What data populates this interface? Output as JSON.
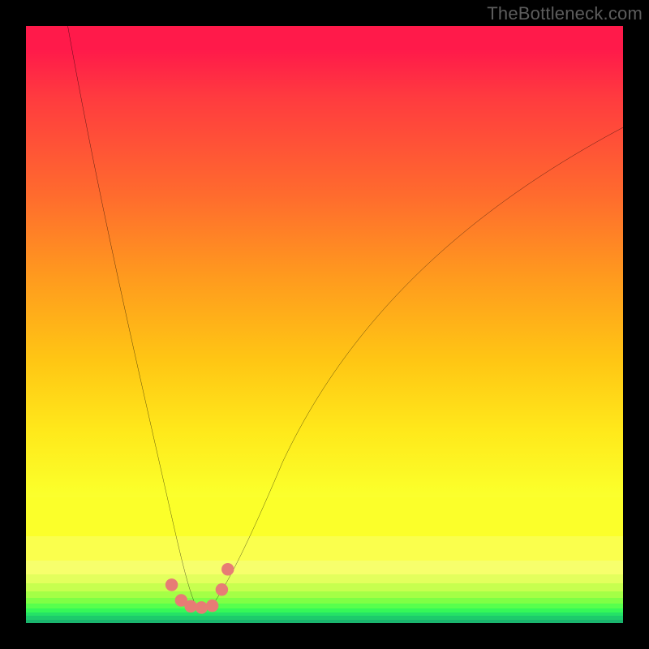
{
  "watermark": "TheBottleneck.com",
  "chart_data": {
    "type": "line",
    "title": "",
    "xlabel": "",
    "ylabel": "",
    "xlim": [
      0,
      100
    ],
    "ylim": [
      0,
      100
    ],
    "series": [
      {
        "name": "curve",
        "x": [
          7,
          10,
          13,
          16,
          19,
          21,
          23,
          24.5,
          26,
          27,
          28.5,
          30,
          31.5,
          33.5,
          36,
          39,
          43,
          48,
          54,
          61,
          69,
          78,
          88,
          100
        ],
        "y": [
          100,
          86,
          73,
          60,
          46,
          35,
          24,
          16,
          10,
          6,
          3.2,
          2.6,
          3.4,
          6,
          11,
          18,
          27,
          37,
          47,
          56,
          64,
          71,
          77,
          83
        ]
      }
    ],
    "markers": [
      {
        "x": 24.4,
        "y": 6.4
      },
      {
        "x": 26.0,
        "y": 3.8
      },
      {
        "x": 27.6,
        "y": 2.8
      },
      {
        "x": 29.4,
        "y": 2.6
      },
      {
        "x": 31.2,
        "y": 2.9
      },
      {
        "x": 32.8,
        "y": 5.6
      },
      {
        "x": 33.8,
        "y": 9.0
      }
    ],
    "background_bands": [
      {
        "from_y": 100,
        "to_y": 21,
        "color": "#ff1a4a-#fbff2a (gradient red→yellow)"
      },
      {
        "from_y": 21,
        "to_y": 14.5,
        "color": "#fbff2a"
      },
      {
        "from_y": 14.5,
        "to_y": 10.5,
        "color": "#faff4d"
      },
      {
        "from_y": 10.5,
        "to_y": 8.2,
        "color": "#f7ff6c"
      },
      {
        "from_y": 8.2,
        "to_y": 6.6,
        "color": "#e3ff5d"
      },
      {
        "from_y": 6.6,
        "to_y": 5.3,
        "color": "#c7ff4f"
      },
      {
        "from_y": 5.3,
        "to_y": 4.2,
        "color": "#a4ff46"
      },
      {
        "from_y": 4.2,
        "to_y": 3.3,
        "color": "#7fff45"
      },
      {
        "from_y": 3.3,
        "to_y": 2.5,
        "color": "#57ff4d"
      },
      {
        "from_y": 2.5,
        "to_y": 1.8,
        "color": "#36f858"
      },
      {
        "from_y": 1.8,
        "to_y": 1.2,
        "color": "#25e266"
      },
      {
        "from_y": 1.2,
        "to_y": 0.6,
        "color": "#1dcb6b"
      },
      {
        "from_y": 0.6,
        "to_y": 0.0,
        "color": "#1ab56d"
      }
    ],
    "colors": {
      "curve_stroke": "#000000",
      "marker_fill": "#e77c75",
      "frame": "#000000"
    }
  }
}
